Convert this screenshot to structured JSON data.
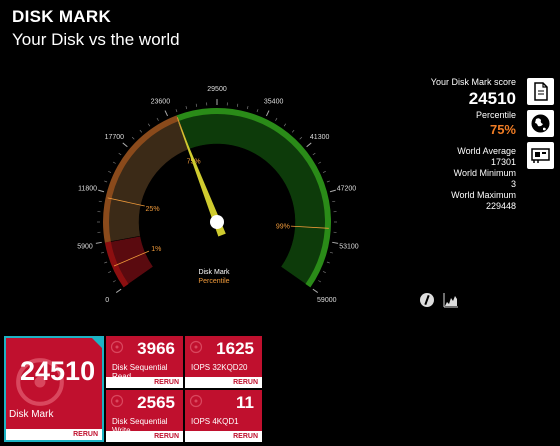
{
  "header": {
    "title": "DISK MARK",
    "subtitle": "Your Disk vs the world"
  },
  "gauge": {
    "min": 0,
    "max": 59000,
    "value": 24510,
    "ticks": [
      "0",
      "5900",
      "11800",
      "17700",
      "23600",
      "29500",
      "35400",
      "41300",
      "47200",
      "53100",
      "59000"
    ],
    "percentile_markers": [
      {
        "label": "1%",
        "value": 2800
      },
      {
        "label": "25%",
        "value": 11200
      },
      {
        "label": "75%",
        "value": 24600
      },
      {
        "label": "99%",
        "value": 51500
      }
    ],
    "center_label": "Disk Mark",
    "center_sublabel": "Percentile",
    "colors": {
      "low": "#5a0a0f",
      "mid": "#3b2a17",
      "high": "#0d3b0a",
      "edge_red": "#8c0f10",
      "edge_orange": "#8a4a1b",
      "edge_green": "#2a8b18",
      "needle": "#cfcb2f"
    }
  },
  "score": {
    "label": "Your Disk Mark score",
    "value": "24510",
    "percentile_label": "Percentile",
    "percentile": "75%",
    "avg_label": "World Average",
    "avg": "17301",
    "min_label": "World Minimum",
    "min": "3",
    "max_label": "World Maximum",
    "max": "229448"
  },
  "side_icons": [
    "document-icon",
    "globe-icon",
    "drive-card-icon"
  ],
  "small_icons": [
    "info-icon",
    "chart-icon"
  ],
  "tiles": {
    "main": {
      "value": "24510",
      "label": "Disk Mark",
      "rerun": "RERUN"
    },
    "seq_read": {
      "value": "3966",
      "label": "Disk Sequential Read",
      "rerun": "RERUN"
    },
    "iops_32": {
      "value": "1625",
      "label": "IOPS 32KQD20",
      "rerun": "RERUN"
    },
    "seq_write": {
      "value": "2565",
      "label": "Disk Sequential Write",
      "rerun": "RERUN"
    },
    "iops_4": {
      "value": "11",
      "label": "IOPS 4KQD1",
      "rerun": "RERUN"
    }
  }
}
